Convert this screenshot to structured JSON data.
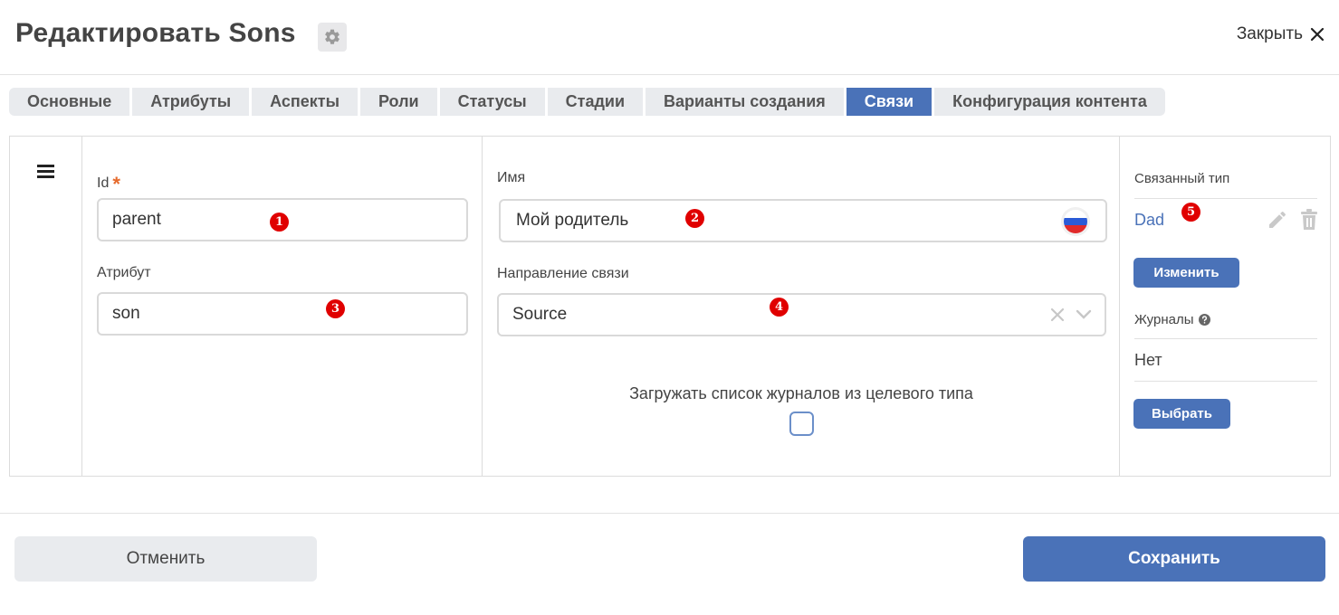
{
  "header": {
    "title": "Редактировать Sons",
    "close_label": "Закрыть"
  },
  "tabs": [
    {
      "label": "Основные",
      "active": false
    },
    {
      "label": "Атрибуты",
      "active": false
    },
    {
      "label": "Аспекты",
      "active": false
    },
    {
      "label": "Роли",
      "active": false
    },
    {
      "label": "Статусы",
      "active": false
    },
    {
      "label": "Стадии",
      "active": false
    },
    {
      "label": "Варианты создания",
      "active": false
    },
    {
      "label": "Связи",
      "active": true
    },
    {
      "label": "Конфигурация контента",
      "active": false
    }
  ],
  "form": {
    "id_label": "Id",
    "id_required_mark": "*",
    "id_value": "parent",
    "name_label": "Имя",
    "name_value": "Мой родитель",
    "attribute_label": "Атрибут",
    "attribute_value": "son",
    "direction_label": "Направление связи",
    "direction_value": "Source",
    "load_journals_label": "Загружать список журналов из целевого типа",
    "load_journals_checked": false
  },
  "related": {
    "type_label": "Связанный тип",
    "type_value": "Dad",
    "change_button": "Изменить",
    "journals_label": "Журналы",
    "journals_value": "Нет",
    "choose_button": "Выбрать"
  },
  "badges": [
    "1",
    "2",
    "3",
    "4",
    "5"
  ],
  "footer": {
    "cancel_label": "Отменить",
    "save_label": "Сохранить"
  },
  "colors": {
    "accent": "#4a72b8",
    "badge": "#e00000",
    "required": "#e66a2c"
  }
}
